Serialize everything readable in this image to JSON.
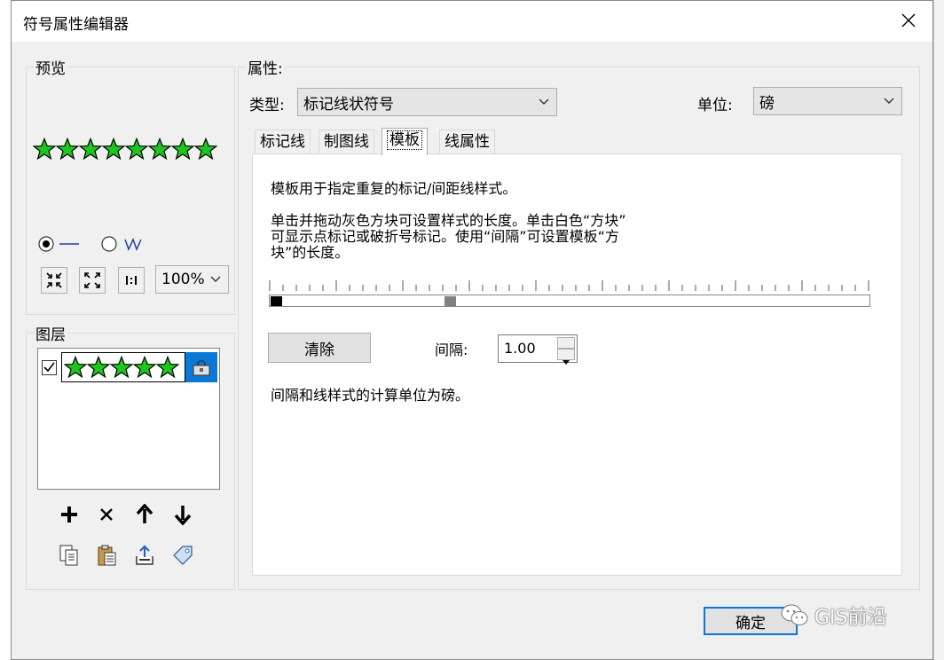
{
  "window": {
    "title": "符号属性编辑器"
  },
  "preview": {
    "legend": "预览",
    "star_color": "#1fc51f",
    "zoom": "100%"
  },
  "layers": {
    "legend": "图层"
  },
  "properties": {
    "legend": "属性:",
    "type_label": "类型:",
    "type_value": "标记线状符号",
    "unit_label": "单位:",
    "unit_value": "磅",
    "tabs": [
      "标记线",
      "制图线",
      "模板",
      "线属性"
    ],
    "active_tab": "模板"
  },
  "template_tab": {
    "intro": "模板用于指定重复的标记/间距线样式。",
    "help_line1": "单击并拖动灰色方块可设置样式的长度。单击白色“方块”",
    "help_line2": "可显示点标记或破折号标记。使用“间隔”可设置模板“方",
    "help_line3": "块”的长度。",
    "clear_label": "清除",
    "interval_label": "间隔:",
    "interval_value": "1.00",
    "unit_note": "间隔和线样式的计算单位为磅。"
  },
  "footer": {
    "ok_label": "确定"
  },
  "watermark": {
    "text": "GIS前沿"
  }
}
